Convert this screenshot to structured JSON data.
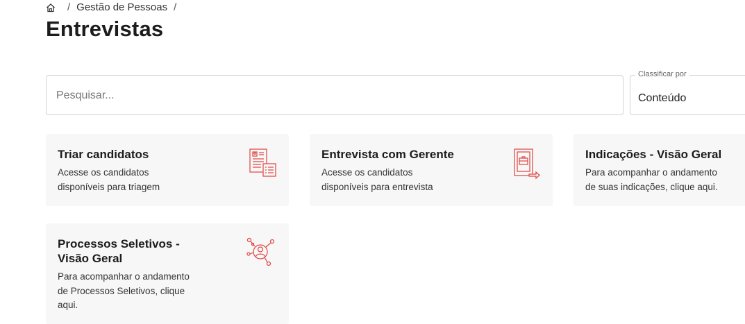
{
  "breadcrumb": {
    "home_icon": "home-icon",
    "items": [
      "Gestão de Pessoas"
    ],
    "separator": "/"
  },
  "page": {
    "title": "Entrevistas"
  },
  "search": {
    "placeholder": "Pesquisar...",
    "value": ""
  },
  "sort": {
    "label": "Classificar por",
    "value": "Conteúdo"
  },
  "theme": {
    "accent": "#e0433f",
    "card_bg": "#f7f7f7"
  },
  "cards": [
    {
      "title": "Triar candidatos",
      "description_lines": [
        "Acesse os candidatos",
        "disponíveis para triagem"
      ],
      "icon": "candidate-list-icon"
    },
    {
      "title": "Entrevista com Gerente",
      "description_lines": [
        "Acesse os candidatos",
        "disponíveis para entrevista"
      ],
      "icon": "briefcase-document-icon"
    },
    {
      "title": "Indicações - Visão Geral",
      "description_lines": [
        "Para acompanhar o andamento",
        "de suas indicações, clique aqui."
      ],
      "icon": ""
    },
    {
      "title_lines": [
        "Processos Seletivos -",
        "Visão Geral"
      ],
      "description_lines": [
        "Para acompanhar o andamento",
        "de Processos Seletivos, clique",
        "aqui."
      ],
      "icon": "network-person-icon"
    }
  ]
}
